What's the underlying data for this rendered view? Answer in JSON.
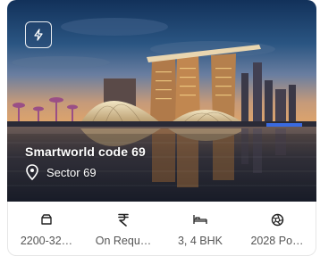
{
  "property": {
    "title": "Smartworld code 69",
    "location": "Sector 69"
  },
  "specs": [
    {
      "icon": "area-icon",
      "value": "2200-32…"
    },
    {
      "icon": "rupee-icon",
      "value": "On Requ…"
    },
    {
      "icon": "bed-icon",
      "value": "3, 4 BHK"
    },
    {
      "icon": "possession-icon",
      "value": "2028 Po…"
    }
  ],
  "badge": {
    "icon": "bolt-icon"
  }
}
